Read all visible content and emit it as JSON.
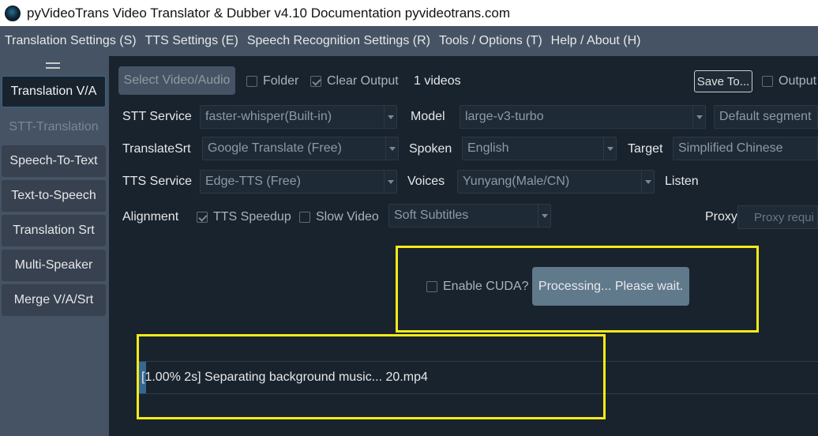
{
  "window": {
    "title": "pyVideoTrans Video Translator & Dubber v4.10 Documentation pyvideotrans.com",
    "icon": "app-icon"
  },
  "menu": [
    {
      "label": "Translation Settings (S)"
    },
    {
      "label": "TTS Settings (E)"
    },
    {
      "label": "Speech Recognition Settings (R)"
    },
    {
      "label": "Tools / Options (T)"
    },
    {
      "label": "Help / About (H)"
    }
  ],
  "sidebar": {
    "items": [
      {
        "label": "Translation V/A",
        "state": "active"
      },
      {
        "label": "STT-Translation",
        "state": "disabled"
      },
      {
        "label": "Speech-To-Text"
      },
      {
        "label": "Text-to-Speech"
      },
      {
        "label": "Translation Srt"
      },
      {
        "label": "Multi-Speaker"
      },
      {
        "label": "Merge V/A/Srt"
      }
    ]
  },
  "toolbar": {
    "select_button": "Select Video/Audio",
    "folder_label": "Folder",
    "folder_checked": false,
    "clear_output_label": "Clear Output",
    "clear_output_checked": true,
    "videos_count": "1 videos",
    "save_to_button": "Save To...",
    "output_label": "Output",
    "output_checked": false
  },
  "form": {
    "stt_service_label": "STT Service",
    "stt_service_value": "faster-whisper(Built-in)",
    "model_label": "Model",
    "model_value": "large-v3-turbo",
    "segment_value": "Default segment",
    "translate_srt_label": "TranslateSrt",
    "translate_srt_value": "Google Translate (Free)",
    "spoken_label": "Spoken",
    "spoken_value": "English",
    "target_label": "Target",
    "target_value": "Simplified Chinese",
    "tts_service_label": "TTS Service",
    "tts_service_value": "Edge-TTS (Free)",
    "voices_label": "Voices",
    "voices_value": "Yunyang(Male/CN)",
    "listen_label": "Listen",
    "alignment_label": "Alignment",
    "tts_speedup_label": "TTS Speedup",
    "tts_speedup_checked": true,
    "slow_video_label": "Slow Video",
    "slow_video_checked": false,
    "subtitles_value": "Soft Subtitles",
    "proxy_label": "Proxy",
    "proxy_placeholder": "Proxy requi"
  },
  "actions": {
    "enable_cuda_label": "Enable CUDA?",
    "enable_cuda_checked": false,
    "processing_button": "Processing... Please wait."
  },
  "progress": {
    "text": "[1.00%  2s]  Separating background music... 20.mp4",
    "percent": 1.0
  },
  "colors": {
    "background": "#19232d",
    "panel": "#455364",
    "accent": "#346792",
    "highlight": "#f6ea1a"
  }
}
